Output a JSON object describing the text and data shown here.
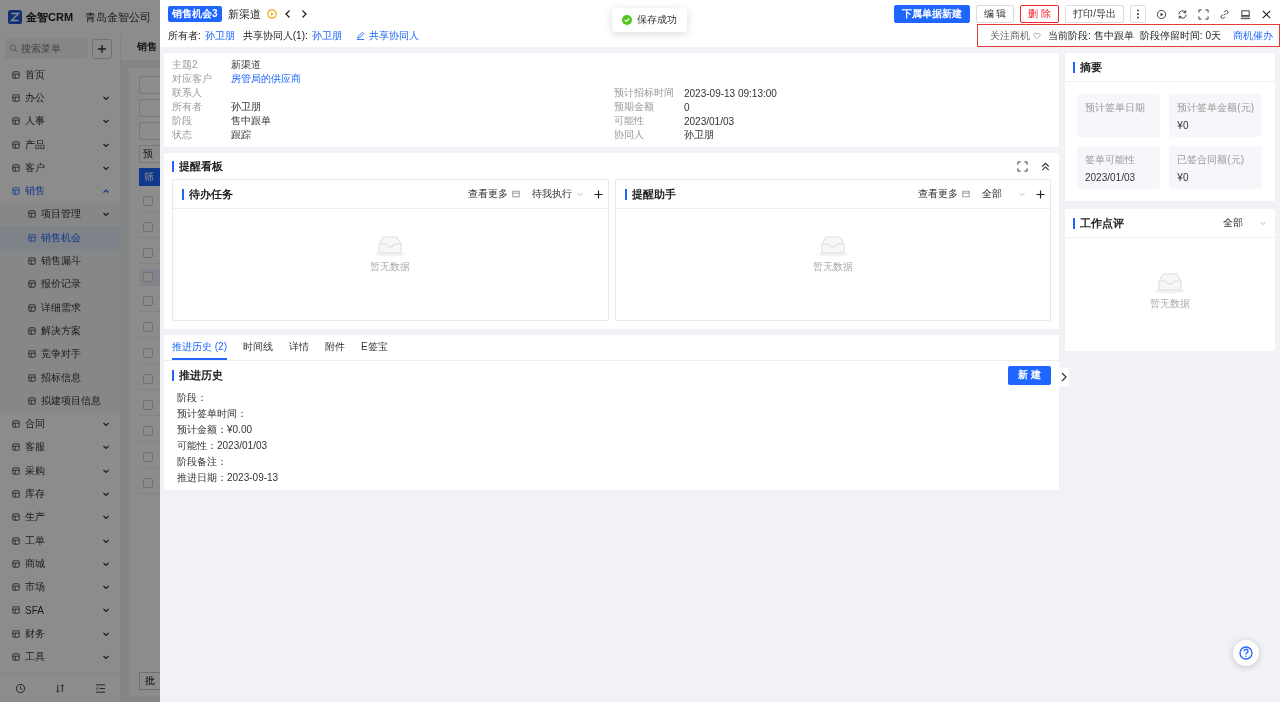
{
  "sidebar": {
    "logo": "金智CRM",
    "company": "青岛金智公司",
    "search": {
      "placeholder": "搜索菜单"
    },
    "menu": [
      {
        "label": "首页",
        "selected": false
      },
      {
        "label": "办公",
        "selected": false,
        "expanded": false
      },
      {
        "label": "人事",
        "selected": false,
        "expanded": false
      },
      {
        "label": "产品",
        "selected": false,
        "expanded": false
      },
      {
        "label": "客户",
        "selected": false,
        "expanded": false
      },
      {
        "label": "销售",
        "selected": false,
        "expanded": true,
        "children": [
          {
            "label": "项目管理",
            "selected": false,
            "expanded": false
          },
          {
            "label": "销售机会",
            "selected": true
          },
          {
            "label": "销售漏斗",
            "selected": false
          },
          {
            "label": "报价记录",
            "selected": false
          },
          {
            "label": "详细需求",
            "selected": false
          },
          {
            "label": "解决方案",
            "selected": false
          },
          {
            "label": "竞争对手",
            "selected": false
          },
          {
            "label": "招标信息",
            "selected": false
          },
          {
            "label": "拟建项目信息",
            "selected": false
          }
        ]
      },
      {
        "label": "合同",
        "selected": false,
        "expanded": false
      },
      {
        "label": "客服",
        "selected": false,
        "expanded": false
      },
      {
        "label": "采购",
        "selected": false,
        "expanded": false
      },
      {
        "label": "库存",
        "selected": false,
        "expanded": false
      },
      {
        "label": "生产",
        "selected": false,
        "expanded": false
      },
      {
        "label": "工单",
        "selected": false,
        "expanded": false
      },
      {
        "label": "商城",
        "selected": false,
        "expanded": false
      },
      {
        "label": "市场",
        "selected": false,
        "expanded": false
      },
      {
        "label": "SFA",
        "selected": false,
        "expanded": false
      },
      {
        "label": "财务",
        "selected": false,
        "expanded": false
      },
      {
        "label": "工具",
        "selected": false,
        "expanded": false
      }
    ]
  },
  "list_page": {
    "title": "销售",
    "filter": "预",
    "filter_button": "筛",
    "footer_button": "批",
    "rows": [
      {
        "checked": false,
        "selected": false
      },
      {
        "checked": false,
        "selected": false
      },
      {
        "checked": false,
        "selected": false
      },
      {
        "checked": false,
        "selected": true
      },
      {
        "checked": false,
        "selected": false
      },
      {
        "checked": false,
        "selected": false
      },
      {
        "checked": false,
        "selected": false
      },
      {
        "checked": false,
        "selected": false
      },
      {
        "checked": false,
        "selected": false
      },
      {
        "checked": false,
        "selected": false
      },
      {
        "checked": false,
        "selected": false
      },
      {
        "checked": false,
        "selected": false
      }
    ]
  },
  "record": {
    "tag": "销售机会3",
    "title": "新渠道",
    "owner_label": "所有者:",
    "owner": "孙卫朋",
    "shared_label": "共享协同人(1):",
    "shared": "孙卫朋",
    "share_link": "共享协同人"
  },
  "toast": "保存成功",
  "toolbar": [
    {
      "label": "下属单据新建",
      "kind": "primary"
    },
    {
      "label": "编 辑",
      "kind": "default"
    },
    {
      "label": "删 除",
      "kind": "danger"
    },
    {
      "label": "打印/导出",
      "kind": "default"
    }
  ],
  "status": {
    "follow": "关注商机",
    "stage_label": "当前阶段:",
    "stage": "售中跟单",
    "stay_label": "阶段停留时间:",
    "stay": "0天",
    "action": "商机催办"
  },
  "details": {
    "left": [
      {
        "label": "主题2",
        "value": "新渠道",
        "kind": "text"
      },
      {
        "label": "对应客户",
        "value": "房管局的供应商",
        "kind": "link"
      },
      {
        "label": "联系人"
      },
      {
        "label": "所有者",
        "value": "孙卫朋",
        "kind": "text"
      },
      {
        "label": "阶段",
        "value": "售中跟单",
        "kind": "text"
      },
      {
        "label": "状态",
        "value": "跟踪",
        "kind": "text"
      }
    ],
    "right": [
      {
        "label": "预计招标时间",
        "value": "2023-09-13 09:13:00",
        "kind": "text"
      },
      {
        "label": "预期金额",
        "value": "0",
        "kind": "text"
      },
      {
        "label": "可能性",
        "value": "2023/01/03",
        "kind": "text"
      },
      {
        "label": "协同人",
        "value": "孙卫朋",
        "kind": "text"
      }
    ]
  },
  "board": {
    "title": "提醒看板",
    "panels": [
      {
        "title": "待办任务",
        "more": "查看更多",
        "filter": "待我执行",
        "empty": "暂无数据"
      },
      {
        "title": "提醒助手",
        "more": "查看更多",
        "filter": "全部",
        "empty": "暂无数据"
      }
    ]
  },
  "tabs": [
    {
      "label": "推进历史 (2)",
      "selected": true
    },
    {
      "label": "时间线",
      "selected": false
    },
    {
      "label": "详情",
      "selected": false
    },
    {
      "label": "附件",
      "selected": false
    },
    {
      "label": "E签宝",
      "selected": false
    }
  ],
  "history": {
    "title": "推进历史",
    "new_button": "新 建",
    "lines": [
      "阶段：",
      "预计签单时间：",
      "预计金额：¥0.00",
      "可能性：2023/01/03",
      "阶段备注：",
      "推进日期：2023-09-13"
    ]
  },
  "summary": {
    "title": "摘要",
    "tiles": [
      {
        "label": "预计签单日期"
      },
      {
        "label": "预计签单金额(元)",
        "value": "¥0"
      },
      {
        "label": "签单可能性",
        "value": "2023/01/03"
      },
      {
        "label": "已签合同额(元)",
        "value": "¥0"
      }
    ]
  },
  "review": {
    "title": "工作点评",
    "filter": "全部",
    "empty": "暂无数据"
  }
}
